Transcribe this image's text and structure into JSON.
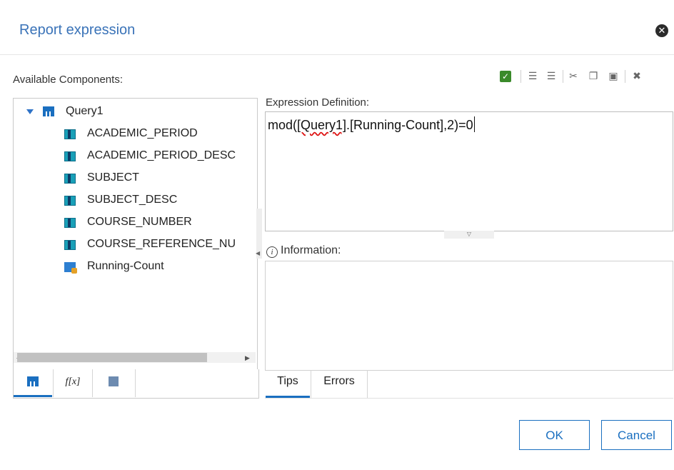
{
  "dialog": {
    "title": "Report expression"
  },
  "left_panel": {
    "heading": "Available Components:",
    "tree": {
      "root": {
        "label": "Query1",
        "icon": "query-icon"
      },
      "items": [
        {
          "label": "ACADEMIC_PERIOD",
          "icon": "data-item-icon"
        },
        {
          "label": "ACADEMIC_PERIOD_DESC",
          "icon": "data-item-icon"
        },
        {
          "label": "SUBJECT",
          "icon": "data-item-icon"
        },
        {
          "label": "SUBJECT_DESC",
          "icon": "data-item-icon"
        },
        {
          "label": "COURSE_NUMBER",
          "icon": "data-item-icon"
        },
        {
          "label": "COURSE_REFERENCE_NU",
          "icon": "data-item-icon"
        },
        {
          "label": "Running-Count",
          "icon": "calculation-icon"
        }
      ]
    },
    "tabs": [
      {
        "icon": "data-items-tab-icon"
      },
      {
        "label": "f[x]",
        "icon": "functions-tab-icon"
      },
      {
        "icon": "data-item-values-tab-icon"
      }
    ]
  },
  "toolbar": {
    "icons": [
      "validate-icon",
      "comment-icon",
      "uncomment-icon",
      "cut-icon",
      "copy-icon",
      "paste-icon",
      "clear-icon"
    ]
  },
  "expression": {
    "label": "Expression Definition:",
    "before": "mod(",
    "underlined": "[Query1]",
    "after": ".[Running-Count],2)=0"
  },
  "information": {
    "label": "Information:"
  },
  "right_tabs": [
    {
      "label": "Tips"
    },
    {
      "label": "Errors"
    }
  ],
  "buttons": {
    "ok": "OK",
    "cancel": "Cancel"
  }
}
